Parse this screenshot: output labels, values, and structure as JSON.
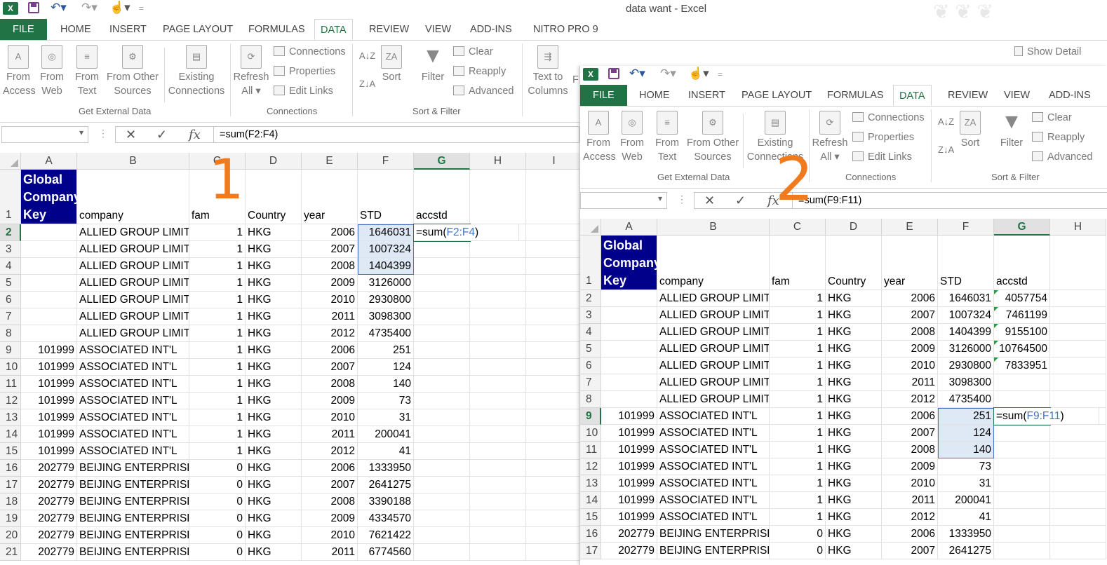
{
  "window_title": "data want - Excel",
  "ribbon_tabs": [
    "FILE",
    "HOME",
    "INSERT",
    "PAGE LAYOUT",
    "FORMULAS",
    "DATA",
    "REVIEW",
    "VIEW",
    "ADD-INS",
    "NITRO PRO 9"
  ],
  "ribbon_tabs_2": [
    "FILE",
    "HOME",
    "INSERT",
    "PAGE LAYOUT",
    "FORMULAS",
    "DATA",
    "REVIEW",
    "VIEW",
    "ADD-INS"
  ],
  "ribbon": {
    "from_access": [
      "From",
      "Access"
    ],
    "from_web": [
      "From",
      "Web"
    ],
    "from_text": [
      "From",
      "Text"
    ],
    "from_other": [
      "From Other",
      "Sources"
    ],
    "existing": [
      "Existing",
      "Connections"
    ],
    "refresh": [
      "Refresh",
      "All"
    ],
    "connections": "Connections",
    "properties": "Properties",
    "edit_links": "Edit Links",
    "sort": "Sort",
    "filter": "Filter",
    "clear": "Clear",
    "reapply": "Reapply",
    "advanced": "Advanced",
    "text_to_columns": [
      "Text to",
      "Columns"
    ],
    "show_detail": "Show Detail",
    "group_get_external": "Get External Data",
    "group_connections": "Connections",
    "group_sort_filter": "Sort & Filter"
  },
  "sheet1": {
    "formula": "=sum(F2:F4)",
    "columns": [
      "A",
      "B",
      "C",
      "D",
      "E",
      "F",
      "G",
      "H",
      "I"
    ],
    "header_row": {
      "A": "Global Company Key",
      "B": "company",
      "C": "fam",
      "D": "Country",
      "E": "year",
      "F": "STD",
      "G": "accstd"
    },
    "rows": [
      {
        "n": "2",
        "A": "",
        "B": "ALLIED GROUP LIMITI",
        "C": "1",
        "D": "HKG",
        "E": "2006",
        "F": "1646031",
        "G": ""
      },
      {
        "n": "3",
        "A": "",
        "B": "ALLIED GROUP LIMITI",
        "C": "1",
        "D": "HKG",
        "E": "2007",
        "F": "1007324",
        "G": ""
      },
      {
        "n": "4",
        "A": "",
        "B": "ALLIED GROUP LIMITI",
        "C": "1",
        "D": "HKG",
        "E": "2008",
        "F": "1404399",
        "G": ""
      },
      {
        "n": "5",
        "A": "",
        "B": "ALLIED GROUP LIMITI",
        "C": "1",
        "D": "HKG",
        "E": "2009",
        "F": "3126000",
        "G": ""
      },
      {
        "n": "6",
        "A": "",
        "B": "ALLIED GROUP LIMITI",
        "C": "1",
        "D": "HKG",
        "E": "2010",
        "F": "2930800",
        "G": ""
      },
      {
        "n": "7",
        "A": "",
        "B": "ALLIED GROUP LIMITI",
        "C": "1",
        "D": "HKG",
        "E": "2011",
        "F": "3098300",
        "G": ""
      },
      {
        "n": "8",
        "A": "",
        "B": "ALLIED GROUP LIMITI",
        "C": "1",
        "D": "HKG",
        "E": "2012",
        "F": "4735400",
        "G": ""
      },
      {
        "n": "9",
        "A": "101999",
        "B": "ASSOCIATED INT'L",
        "C": "1",
        "D": "HKG",
        "E": "2006",
        "F": "251",
        "G": ""
      },
      {
        "n": "10",
        "A": "101999",
        "B": "ASSOCIATED INT'L",
        "C": "1",
        "D": "HKG",
        "E": "2007",
        "F": "124",
        "G": ""
      },
      {
        "n": "11",
        "A": "101999",
        "B": "ASSOCIATED INT'L",
        "C": "1",
        "D": "HKG",
        "E": "2008",
        "F": "140",
        "G": ""
      },
      {
        "n": "12",
        "A": "101999",
        "B": "ASSOCIATED INT'L",
        "C": "1",
        "D": "HKG",
        "E": "2009",
        "F": "73",
        "G": ""
      },
      {
        "n": "13",
        "A": "101999",
        "B": "ASSOCIATED INT'L",
        "C": "1",
        "D": "HKG",
        "E": "2010",
        "F": "31",
        "G": ""
      },
      {
        "n": "14",
        "A": "101999",
        "B": "ASSOCIATED INT'L",
        "C": "1",
        "D": "HKG",
        "E": "2011",
        "F": "200041",
        "G": ""
      },
      {
        "n": "15",
        "A": "101999",
        "B": "ASSOCIATED INT'L",
        "C": "1",
        "D": "HKG",
        "E": "2012",
        "F": "41",
        "G": ""
      },
      {
        "n": "16",
        "A": "202779",
        "B": "BEIJING ENTERPRISES",
        "C": "0",
        "D": "HKG",
        "E": "2006",
        "F": "1333950",
        "G": ""
      },
      {
        "n": "17",
        "A": "202779",
        "B": "BEIJING ENTERPRISES",
        "C": "0",
        "D": "HKG",
        "E": "2007",
        "F": "2641275",
        "G": ""
      },
      {
        "n": "18",
        "A": "202779",
        "B": "BEIJING ENTERPRISES",
        "C": "0",
        "D": "HKG",
        "E": "2008",
        "F": "3390188",
        "G": ""
      },
      {
        "n": "19",
        "A": "202779",
        "B": "BEIJING ENTERPRISES",
        "C": "0",
        "D": "HKG",
        "E": "2009",
        "F": "4334570",
        "G": ""
      },
      {
        "n": "20",
        "A": "202779",
        "B": "BEIJING ENTERPRISES",
        "C": "0",
        "D": "HKG",
        "E": "2010",
        "F": "7621422",
        "G": ""
      },
      {
        "n": "21",
        "A": "202779",
        "B": "BEIJING ENTERPRISES",
        "C": "0",
        "D": "HKG",
        "E": "2011",
        "F": "6774560",
        "G": ""
      }
    ],
    "active_formula_prefix": "=sum(",
    "active_formula_ref": "F2:F4",
    "active_formula_suffix": ")"
  },
  "sheet2": {
    "formula": "=sum(F9:F11)",
    "columns": [
      "A",
      "B",
      "C",
      "D",
      "E",
      "F",
      "G",
      "H"
    ],
    "header_row": {
      "A": "Global Company Key",
      "B": "company",
      "C": "fam",
      "D": "Country",
      "E": "year",
      "F": "STD",
      "G": "accstd"
    },
    "rows": [
      {
        "n": "2",
        "A": "",
        "B": "ALLIED GROUP LIMITI",
        "C": "1",
        "D": "HKG",
        "E": "2006",
        "F": "1646031",
        "G": "4057754"
      },
      {
        "n": "3",
        "A": "",
        "B": "ALLIED GROUP LIMITI",
        "C": "1",
        "D": "HKG",
        "E": "2007",
        "F": "1007324",
        "G": "7461199"
      },
      {
        "n": "4",
        "A": "",
        "B": "ALLIED GROUP LIMITI",
        "C": "1",
        "D": "HKG",
        "E": "2008",
        "F": "1404399",
        "G": "9155100"
      },
      {
        "n": "5",
        "A": "",
        "B": "ALLIED GROUP LIMITI",
        "C": "1",
        "D": "HKG",
        "E": "2009",
        "F": "3126000",
        "G": "10764500"
      },
      {
        "n": "6",
        "A": "",
        "B": "ALLIED GROUP LIMITI",
        "C": "1",
        "D": "HKG",
        "E": "2010",
        "F": "2930800",
        "G": "7833951"
      },
      {
        "n": "7",
        "A": "",
        "B": "ALLIED GROUP LIMITI",
        "C": "1",
        "D": "HKG",
        "E": "2011",
        "F": "3098300",
        "G": ""
      },
      {
        "n": "8",
        "A": "",
        "B": "ALLIED GROUP LIMITI",
        "C": "1",
        "D": "HKG",
        "E": "2012",
        "F": "4735400",
        "G": ""
      },
      {
        "n": "9",
        "A": "101999",
        "B": "ASSOCIATED INT'L",
        "C": "1",
        "D": "HKG",
        "E": "2006",
        "F": "251",
        "G": ""
      },
      {
        "n": "10",
        "A": "101999",
        "B": "ASSOCIATED INT'L",
        "C": "1",
        "D": "HKG",
        "E": "2007",
        "F": "124",
        "G": ""
      },
      {
        "n": "11",
        "A": "101999",
        "B": "ASSOCIATED INT'L",
        "C": "1",
        "D": "HKG",
        "E": "2008",
        "F": "140",
        "G": ""
      },
      {
        "n": "12",
        "A": "101999",
        "B": "ASSOCIATED INT'L",
        "C": "1",
        "D": "HKG",
        "E": "2009",
        "F": "73",
        "G": ""
      },
      {
        "n": "13",
        "A": "101999",
        "B": "ASSOCIATED INT'L",
        "C": "1",
        "D": "HKG",
        "E": "2010",
        "F": "31",
        "G": ""
      },
      {
        "n": "14",
        "A": "101999",
        "B": "ASSOCIATED INT'L",
        "C": "1",
        "D": "HKG",
        "E": "2011",
        "F": "200041",
        "G": ""
      },
      {
        "n": "15",
        "A": "101999",
        "B": "ASSOCIATED INT'L",
        "C": "1",
        "D": "HKG",
        "E": "2012",
        "F": "41",
        "G": ""
      },
      {
        "n": "16",
        "A": "202779",
        "B": "BEIJING ENTERPRISES",
        "C": "0",
        "D": "HKG",
        "E": "2006",
        "F": "1333950",
        "G": ""
      },
      {
        "n": "17",
        "A": "202779",
        "B": "BEIJING ENTERPRISES",
        "C": "0",
        "D": "HKG",
        "E": "2007",
        "F": "2641275",
        "G": ""
      }
    ],
    "active_formula_prefix": "=sum(",
    "active_formula_ref": "F9:F11",
    "active_formula_suffix": ")"
  },
  "annotations": [
    "1",
    "2"
  ],
  "colors": {
    "excel_green": "#217346",
    "header_blue": "#00008b",
    "annotation_orange": "#f07a1e",
    "ref_blue": "#4472c4"
  }
}
